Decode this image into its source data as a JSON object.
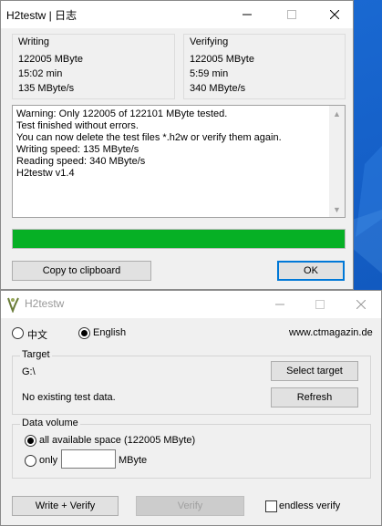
{
  "results_window": {
    "title": "H2testw | 日志",
    "writing": {
      "label": "Writing",
      "size": "122005 MByte",
      "time": "15:02 min",
      "speed": "135 MByte/s"
    },
    "verifying": {
      "label": "Verifying",
      "size": "122005 MByte",
      "time": "5:59 min",
      "speed": "340 MByte/s"
    },
    "log": [
      "Warning: Only 122005 of 122101 MByte tested.",
      "Test finished without errors.",
      "You can now delete the test files *.h2w or verify them again.",
      "Writing speed: 135 MByte/s",
      "Reading speed: 340 MByte/s",
      "H2testw v1.4"
    ],
    "progress": 1.0,
    "progress_color": "#06b025",
    "copy_label": "Copy to clipboard",
    "ok_label": "OK"
  },
  "main_window": {
    "title": "H2testw",
    "lang_other": "中文",
    "lang_english": "English",
    "website": "www.ctmagazin.de",
    "target": {
      "label": "Target",
      "path": "G:\\",
      "status": "No existing test data.",
      "select_label": "Select target",
      "refresh_label": "Refresh"
    },
    "volume": {
      "label": "Data volume",
      "all_label": "all available space (122005 MByte)",
      "only_label": "only",
      "only_value": "",
      "unit": "MByte"
    },
    "write_verify_label": "Write + Verify",
    "verify_label": "Verify",
    "endless_label": "endless verify"
  },
  "colors": {
    "desktop": "#1560c8",
    "accent": "#0078d7"
  }
}
